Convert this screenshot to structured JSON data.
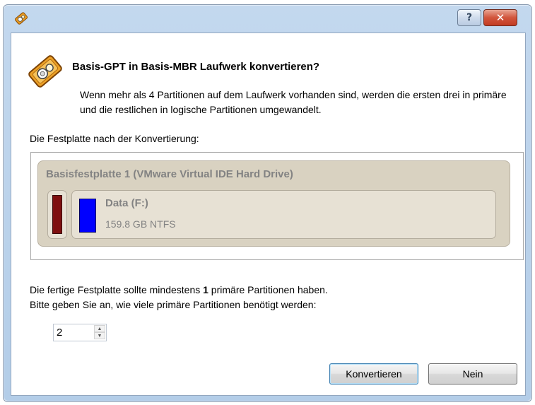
{
  "dialog": {
    "heading": "Basis-GPT in Basis-MBR Laufwerk konvertieren?",
    "description": "Wenn mehr als 4 Partitionen auf dem Laufwerk vorhanden sind, werden die ersten drei in primäre und die restlichen in logische Partitionen umgewandelt.",
    "after_label": "Die Festplatte nach der Konvertierung:",
    "help_glyph": "?",
    "close_glyph": "✕"
  },
  "disk": {
    "title": "Basisfestplatte 1 (VMware Virtual IDE Hard Drive)",
    "partitions": [
      {
        "name": "",
        "color": "#7e0f0f"
      },
      {
        "name": "Data (F:)",
        "info": "159.8 GB NTFS",
        "color": "#0000ff"
      }
    ]
  },
  "notes": {
    "line1_prefix": "Die fertige Festplatte sollte mindestens ",
    "line1_number": "1",
    "line1_suffix": " primäre Partitionen haben.",
    "line2": "Bitte geben Sie an, wie viele primäre Partitionen benötigt werden:"
  },
  "spinner": {
    "value": "2"
  },
  "buttons": {
    "convert": "Konvertieren",
    "no": "Nein"
  },
  "icons": [
    "app-icon",
    "help-icon",
    "close-icon",
    "spin-up-icon",
    "spin-down-icon"
  ]
}
